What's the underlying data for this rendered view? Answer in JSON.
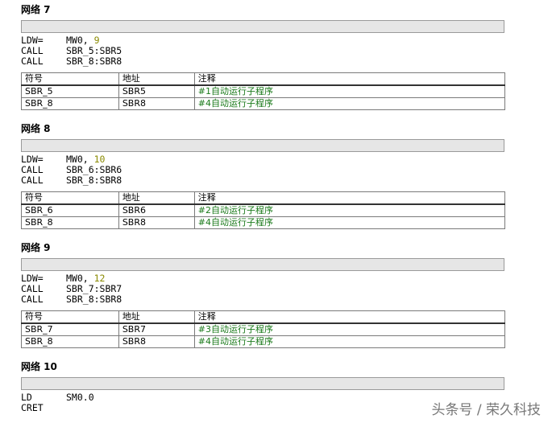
{
  "networks": [
    {
      "title": "网络 7",
      "code": [
        {
          "op": "LDW=",
          "args": "MW0, ",
          "num": "9"
        },
        {
          "op": "CALL",
          "args": "SBR_5:SBR5",
          "num": ""
        },
        {
          "op": "CALL",
          "args": "SBR_8:SBR8",
          "num": ""
        }
      ],
      "table": {
        "headers": [
          "符号",
          "地址",
          "注释"
        ],
        "rows": [
          [
            "SBR_5",
            "SBR5",
            "#1自动运行子程序"
          ],
          [
            "SBR_8",
            "SBR8",
            "#4自动运行子程序"
          ]
        ]
      }
    },
    {
      "title": "网络 8",
      "code": [
        {
          "op": "LDW=",
          "args": "MW0, ",
          "num": "10"
        },
        {
          "op": "CALL",
          "args": "SBR_6:SBR6",
          "num": ""
        },
        {
          "op": "CALL",
          "args": "SBR_8:SBR8",
          "num": ""
        }
      ],
      "table": {
        "headers": [
          "符号",
          "地址",
          "注释"
        ],
        "rows": [
          [
            "SBR_6",
            "SBR6",
            "#2自动运行子程序"
          ],
          [
            "SBR_8",
            "SBR8",
            "#4自动运行子程序"
          ]
        ]
      }
    },
    {
      "title": "网络 9",
      "code": [
        {
          "op": "LDW=",
          "args": "MW0, ",
          "num": "12"
        },
        {
          "op": "CALL",
          "args": "SBR_7:SBR7",
          "num": ""
        },
        {
          "op": "CALL",
          "args": "SBR_8:SBR8",
          "num": ""
        }
      ],
      "table": {
        "headers": [
          "符号",
          "地址",
          "注释"
        ],
        "rows": [
          [
            "SBR_7",
            "SBR7",
            "#3自动运行子程序"
          ],
          [
            "SBR_8",
            "SBR8",
            "#4自动运行子程序"
          ]
        ]
      }
    },
    {
      "title": "网络 10",
      "code": [
        {
          "op": "LD",
          "args": "SM0.0",
          "num": ""
        },
        {
          "op": "CRET",
          "args": "",
          "num": ""
        }
      ]
    }
  ],
  "watermark": "头条号 / 荣久科技",
  "colors": {
    "comment_green": "#1a7a1a",
    "number_olive": "#8a8a00",
    "comment_bar": "#e6e6e6"
  }
}
